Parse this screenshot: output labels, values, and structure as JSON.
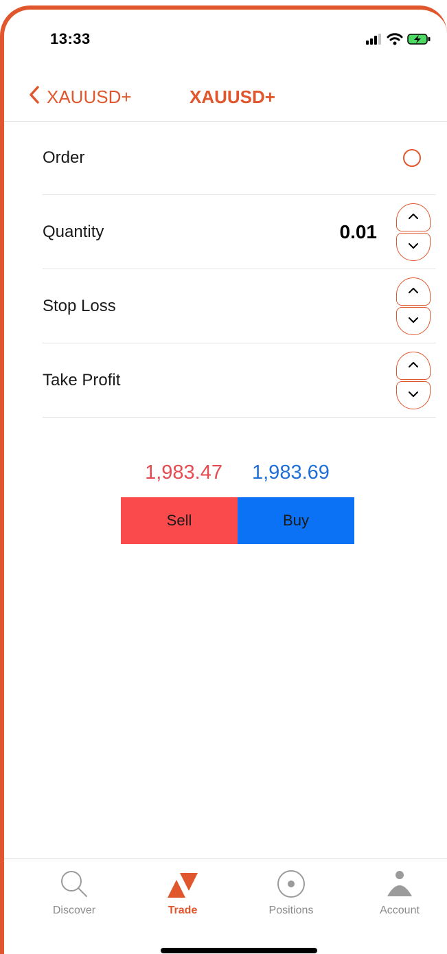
{
  "status_bar": {
    "time": "13:33"
  },
  "nav": {
    "back_label": "XAUUSD+",
    "title": "XAUUSD+"
  },
  "form": {
    "order_label": "Order",
    "quantity_label": "Quantity",
    "quantity_value": "0.01",
    "stop_loss_label": "Stop Loss",
    "take_profit_label": "Take Profit"
  },
  "prices": {
    "sell_price": "1,983.47",
    "buy_price": "1,983.69"
  },
  "actions": {
    "sell_label": "Sell",
    "buy_label": "Buy"
  },
  "tabs": [
    {
      "label": "Discover",
      "icon": "search-icon",
      "active": false
    },
    {
      "label": "Trade",
      "icon": "trade-icon",
      "active": true
    },
    {
      "label": "Positions",
      "icon": "positions-icon",
      "active": false
    },
    {
      "label": "Account",
      "icon": "account-icon",
      "active": false
    }
  ],
  "colors": {
    "accent": "#E0572D",
    "sell_price": "#E54B50",
    "buy_price": "#1E6FD8",
    "sell_button": "#FB4A4C",
    "buy_button": "#0B72F5"
  }
}
